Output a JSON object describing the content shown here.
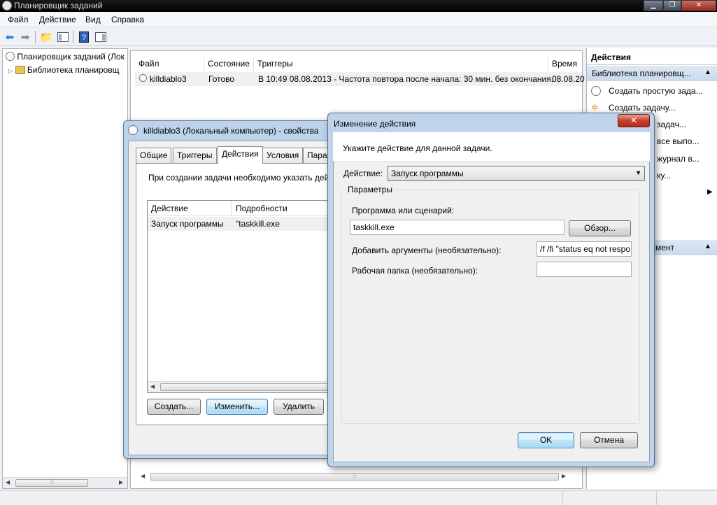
{
  "main_window": {
    "title": "Планировщик заданий",
    "menu": [
      "Файл",
      "Действие",
      "Вид",
      "Справка"
    ]
  },
  "tree": {
    "root": "Планировщик заданий (Лок",
    "library": "Библиотека планировщ"
  },
  "task_list": {
    "columns": [
      "Файл",
      "Состояние",
      "Триггеры",
      "Время"
    ],
    "rows": [
      {
        "name": "killdiablo3",
        "state": "Готово",
        "trigger": "В 10:49 08.08.2013 - Частота повтора после начала: 30 мин. без окончания.",
        "time": "08.08.20"
      }
    ]
  },
  "actions_pane": {
    "header": "Действия",
    "section": "Библиотека планировщ...",
    "items": [
      "Создать простую зада...",
      "Создать задачу...",
      "задач...",
      "все выпо...",
      "журнал в...",
      "ку..."
    ],
    "section2": "мент"
  },
  "properties_window": {
    "title": "killdiablo3 (Локальный компьютер) - свойства",
    "tabs": [
      "Общие",
      "Триггеры",
      "Действия",
      "Условия",
      "Пара"
    ],
    "hint": "При создании задачи необходимо указать дейс",
    "columns": [
      "Действие",
      "Подробности"
    ],
    "row": {
      "action": "Запуск программы",
      "details": "\"taskkill.exe"
    },
    "buttons": {
      "create": "Создать...",
      "edit": "Изменить...",
      "delete": "Удалить"
    }
  },
  "edit_dialog": {
    "title": "Изменение действия",
    "prompt": "Укажите действие для данной задачи.",
    "action_label": "Действие:",
    "action_value": "Запуск программы",
    "group_label": "Параметры",
    "program_label": "Программа или сценарий:",
    "program_value": "taskkill.exe",
    "browse_button": "Обзор...",
    "args_label": "Добавить аргументы (необязательно):",
    "args_value": "/f /fi \"status eq not respo",
    "workdir_label": "Рабочая папка (необязательно):",
    "workdir_value": "",
    "ok_button": "OK",
    "cancel_button": "Отмена"
  },
  "colors": {
    "accent": "#3c7fb1",
    "title_bar": "#000000",
    "frame": "#bcd3ea"
  }
}
